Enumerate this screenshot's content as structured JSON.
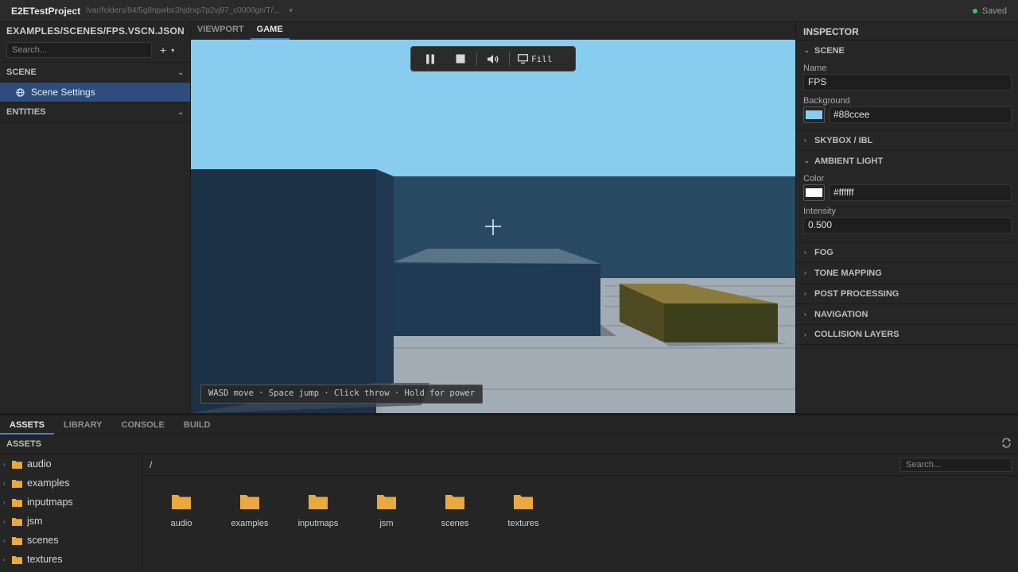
{
  "titlebar": {
    "project": "E2ETestProject",
    "path": "/var/folders/94/5g8npwbx3hjdrxp7p2vj97_c0000gn/T/...",
    "status": "Saved"
  },
  "left_panel": {
    "file_title": "EXAMPLES/SCENES/FPS.VSCN.JSON",
    "search_placeholder": "Search...",
    "add_symbol": "+",
    "scene_section": "SCENE",
    "scene_settings": "Scene Settings",
    "entities_section": "ENTITIES"
  },
  "view_tabs": [
    "VIEWPORT",
    "GAME"
  ],
  "active_view_tab": "GAME",
  "game": {
    "fill_label": "Fill",
    "hint": "WASD move · Space jump · Click throw · Hold for power"
  },
  "inspector": {
    "title": "INSPECTOR",
    "scene_section": "SCENE",
    "name_label": "Name",
    "name_value": "FPS",
    "background_label": "Background",
    "background_value": "#88ccee",
    "background_color": "#88ccee",
    "skybox_section": "SKYBOX / IBL",
    "ambient_section": "AMBIENT LIGHT",
    "color_label": "Color",
    "color_value": "#ffffff",
    "ambient_color": "#ffffff",
    "intensity_label": "Intensity",
    "intensity_value": "0.500",
    "collapsed_sections": [
      "FOG",
      "TONE MAPPING",
      "POST PROCESSING",
      "NAVIGATION",
      "COLLISION LAYERS"
    ]
  },
  "bottom_tabs": [
    "ASSETS",
    "LIBRARY",
    "CONSOLE",
    "BUILD"
  ],
  "active_bottom_tab": "ASSETS",
  "assets": {
    "title": "ASSETS",
    "path": "/",
    "search_placeholder": "Search...",
    "tree": [
      "audio",
      "examples",
      "inputmaps",
      "jsm",
      "scenes",
      "textures"
    ],
    "folders": [
      "audio",
      "examples",
      "inputmaps",
      "jsm",
      "scenes",
      "textures"
    ]
  },
  "colors": {
    "accent": "#4b7ed1",
    "folder": "#e8a93e",
    "saved_dot": "#3fbf5f",
    "selection": "#2e4d7d"
  }
}
